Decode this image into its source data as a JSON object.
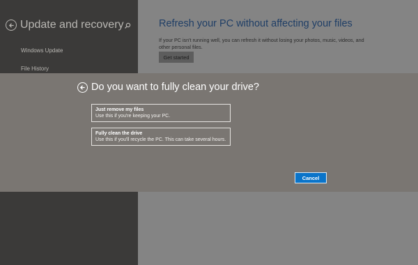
{
  "sidebar": {
    "title": "Update and recovery",
    "items": [
      {
        "label": "Windows Update"
      },
      {
        "label": "File History"
      }
    ]
  },
  "main": {
    "title": "Refresh your PC without affecting your files",
    "description": "If your PC isn't running well, you can refresh it without losing your photos, music, videos, and other personal files.",
    "get_started_label": "Get started"
  },
  "dialog": {
    "title": "Do you want to fully clean your drive?",
    "options": [
      {
        "title": "Just remove my files",
        "description": "Use this if you're keeping your PC."
      },
      {
        "title": "Fully clean the drive",
        "description": "Use this if you'll recycle the PC. This can take several hours."
      }
    ],
    "cancel_label": "Cancel"
  },
  "colors": {
    "accent": "#0a74c9",
    "dialog_background": "#7a7672",
    "sidebar_background": "#3b3a39",
    "page_title": "#1f3e66"
  },
  "icons": [
    "back-arrow-icon",
    "search-icon"
  ]
}
